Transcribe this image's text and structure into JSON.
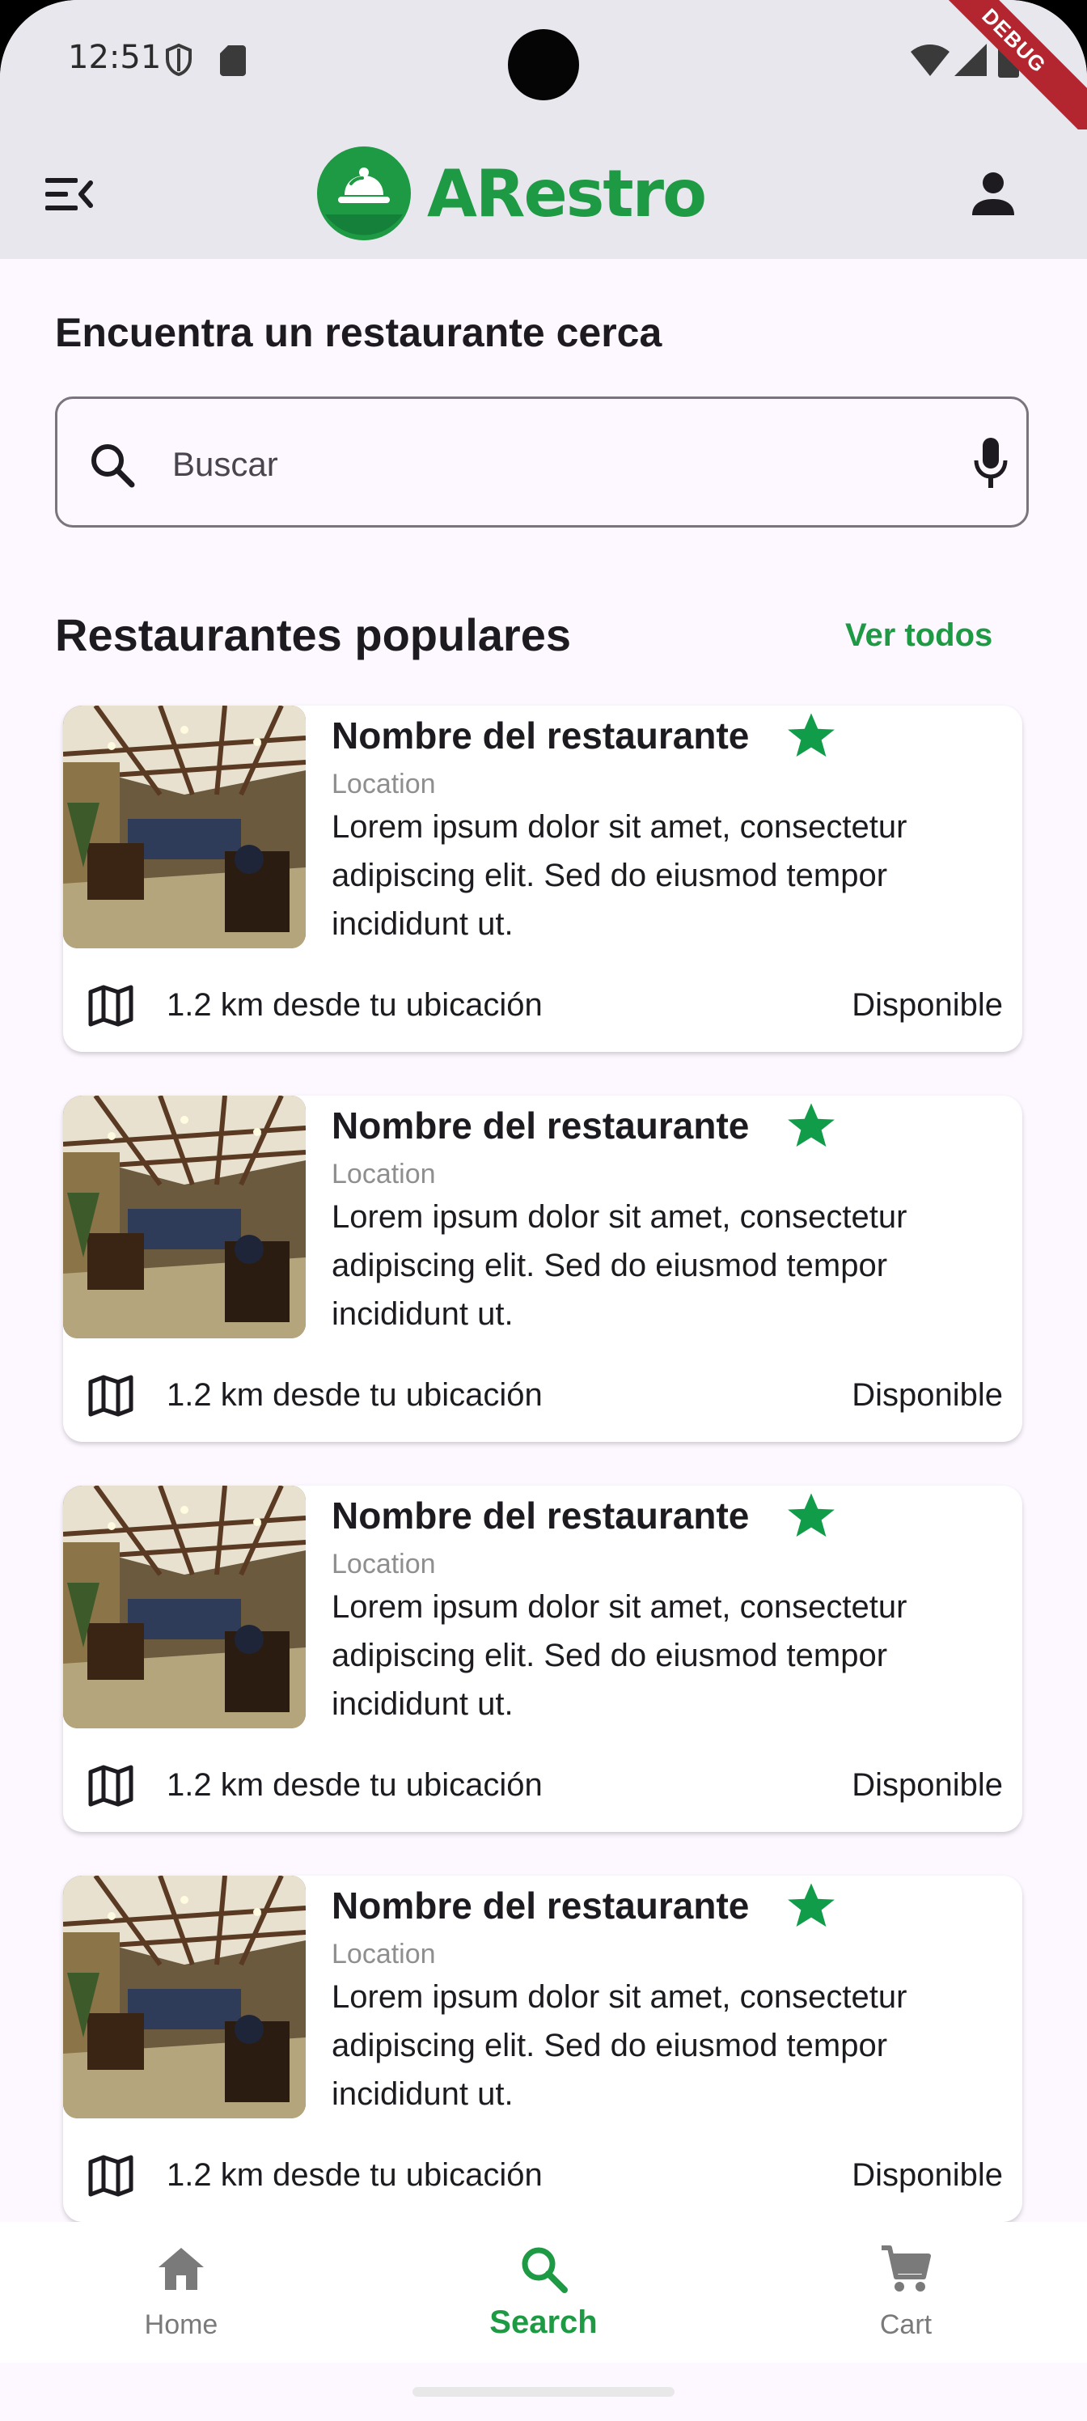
{
  "status_bar": {
    "time": "12:51",
    "debug_label": "DEBUG"
  },
  "app_bar": {
    "app_name": "ARestro"
  },
  "search": {
    "heading": "Encuentra un restaurante cerca",
    "placeholder": "Buscar"
  },
  "popular": {
    "title": "Restaurantes populares",
    "see_all": "Ver todos",
    "items": [
      {
        "name": "Nombre del restaurante",
        "location": "Location",
        "description": "Lorem ipsum dolor sit amet, consectetur adipiscing elit. Sed do eiusmod tempor incididunt ut.",
        "distance": "1.2 km desde tu ubicación",
        "availability": "Disponible"
      },
      {
        "name": "Nombre del restaurante",
        "location": "Location",
        "description": "Lorem ipsum dolor sit amet, consectetur adipiscing elit. Sed do eiusmod tempor incididunt ut.",
        "distance": "1.2 km desde tu ubicación",
        "availability": "Disponible"
      },
      {
        "name": "Nombre del restaurante",
        "location": "Location",
        "description": "Lorem ipsum dolor sit amet, consectetur adipiscing elit. Sed do eiusmod tempor incididunt ut.",
        "distance": "1.2 km desde tu ubicación",
        "availability": "Disponible"
      },
      {
        "name": "Nombre del restaurante",
        "location": "Location",
        "description": "Lorem ipsum dolor sit amet, consectetur adipiscing elit. Sed do eiusmod tempor incididunt ut.",
        "distance": "1.2 km desde tu ubicación",
        "availability": "Disponible"
      }
    ]
  },
  "bottom_nav": {
    "items": [
      {
        "label": "Home",
        "icon": "home-icon",
        "active": false
      },
      {
        "label": "Search",
        "icon": "search-icon",
        "active": true
      },
      {
        "label": "Cart",
        "icon": "cart-icon",
        "active": false
      }
    ]
  },
  "colors": {
    "accent": "#1f9a44",
    "star": "#109c48",
    "app_bar": "#e9e7ee",
    "background": "#fdf7ff"
  }
}
